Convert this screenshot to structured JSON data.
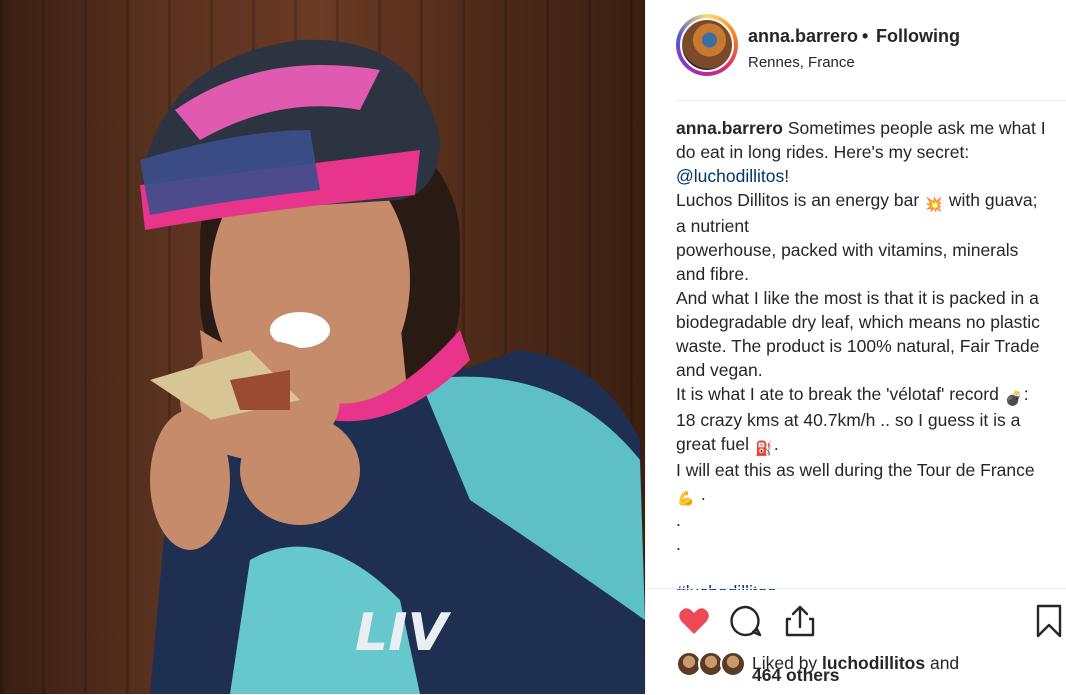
{
  "post": {
    "username": "anna.barrero",
    "separator": "•",
    "follow_status": "Following",
    "location": "Rennes, France"
  },
  "caption": {
    "author": "anna.barrero",
    "line1": "Sometimes people ask me what I do eat in long rides. Here's my secret: ",
    "mention": "@luchodillitos",
    "line1_end": "!",
    "line2a": "Luchos Dillitos is an energy bar ",
    "line2b": " with guava; a nutrient",
    "line3": "powerhouse, packed with vitamins, minerals and fibre.",
    "line4": "And what I like the most is that it is packed in a biodegradable dry leaf, which means no plastic waste. The product is 100% natural, Fair Trade and vegan.",
    "line5a": "It is what I ate to break the 'vélotaf' record ",
    "line5b": ": 18 crazy kms at 40.7km/h .. so I guess it is a great fuel ",
    "line5c": ".",
    "line6a": "I will eat this as well during the Tour de France ",
    "line6b": " .",
    "dot1": ".",
    "dot2": ".",
    "hashtag": "#luchodillitos",
    "emoji1": "💥",
    "emoji2": "💣",
    "emoji3": "⛽",
    "emoji4": "💪"
  },
  "likes": {
    "prefix": "Liked by ",
    "user": "luchodillitos",
    "middle": " and",
    "count": "464 others"
  },
  "colors": {
    "heart": "#ed4956",
    "link": "#003569",
    "border": "#efefef"
  },
  "icons": [
    "heart-icon",
    "comment-icon",
    "share-icon",
    "bookmark-icon"
  ]
}
